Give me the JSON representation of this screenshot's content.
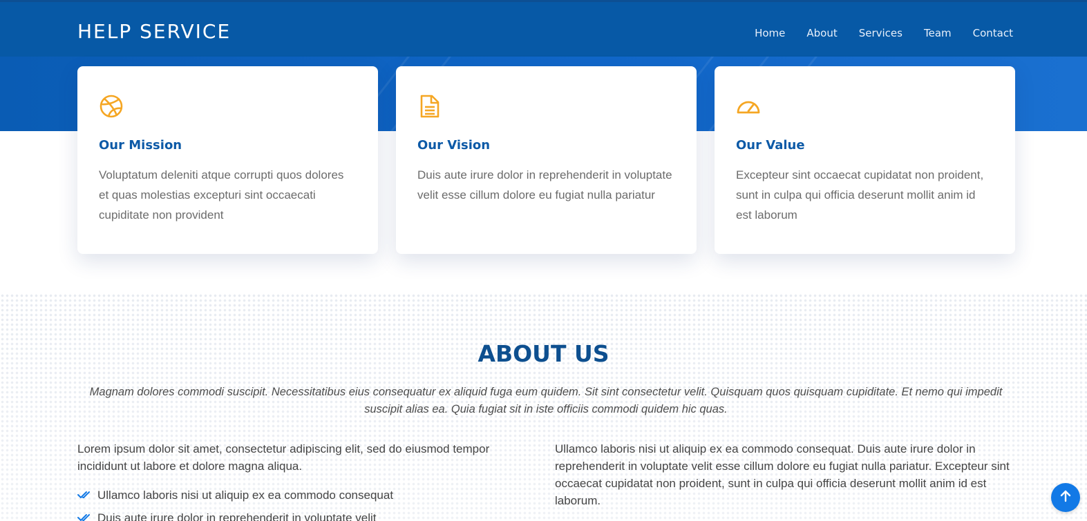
{
  "header": {
    "logo": "HELP SERVICE",
    "nav": [
      "Home",
      "About",
      "Services",
      "Team",
      "Contact"
    ]
  },
  "cards": [
    {
      "icon": "dribbble-ball-icon",
      "title": "Our Mission",
      "text": "Voluptatum deleniti atque corrupti quos dolores et quas molestias excepturi sint occaecati cupiditate non provident"
    },
    {
      "icon": "document-icon",
      "title": "Our Vision",
      "text": "Duis aute irure dolor in reprehenderit in voluptate velit esse cillum dolore eu fugiat nulla pariatur"
    },
    {
      "icon": "speedometer-icon",
      "title": "Our Value",
      "text": "Excepteur sint occaecat cupidatat non proident, sunt in culpa qui officia deserunt mollit anim id est laborum"
    }
  ],
  "about": {
    "title": "ABOUT US",
    "intro": "Magnam dolores commodi suscipit. Necessitatibus eius consequatur ex aliquid fuga eum quidem. Sit sint consectetur velit. Quisquam quos quisquam cupiditate. Et nemo qui impedit suscipit alias ea. Quia fugiat sit in iste officiis commodi quidem hic quas.",
    "left_paragraph": "Lorem ipsum dolor sit amet, consectetur adipiscing elit, sed do eiusmod tempor incididunt ut labore et dolore magna aliqua.",
    "checklist": [
      "Ullamco laboris nisi ut aliquip ex ea commodo consequat",
      "Duis aute irure dolor in reprehenderit in voluptate velit"
    ],
    "right_paragraph": "Ullamco laboris nisi ut aliquip ex ea commodo consequat. Duis aute irure dolor in reprehenderit in voluptate velit esse cillum dolore eu fugiat nulla pariatur. Excepteur sint occaecat cupidatat non proident, sunt in culpa qui officia deserunt mollit anim id est laborum."
  },
  "back_to_top_icon": "arrow-up-icon",
  "colors": {
    "header": "#0759a6",
    "hero": "#1167c9",
    "accent_icon": "#f5a623",
    "heading": "#0d5aa7",
    "back_to_top": "#1279e6",
    "check": "#1279e6"
  }
}
